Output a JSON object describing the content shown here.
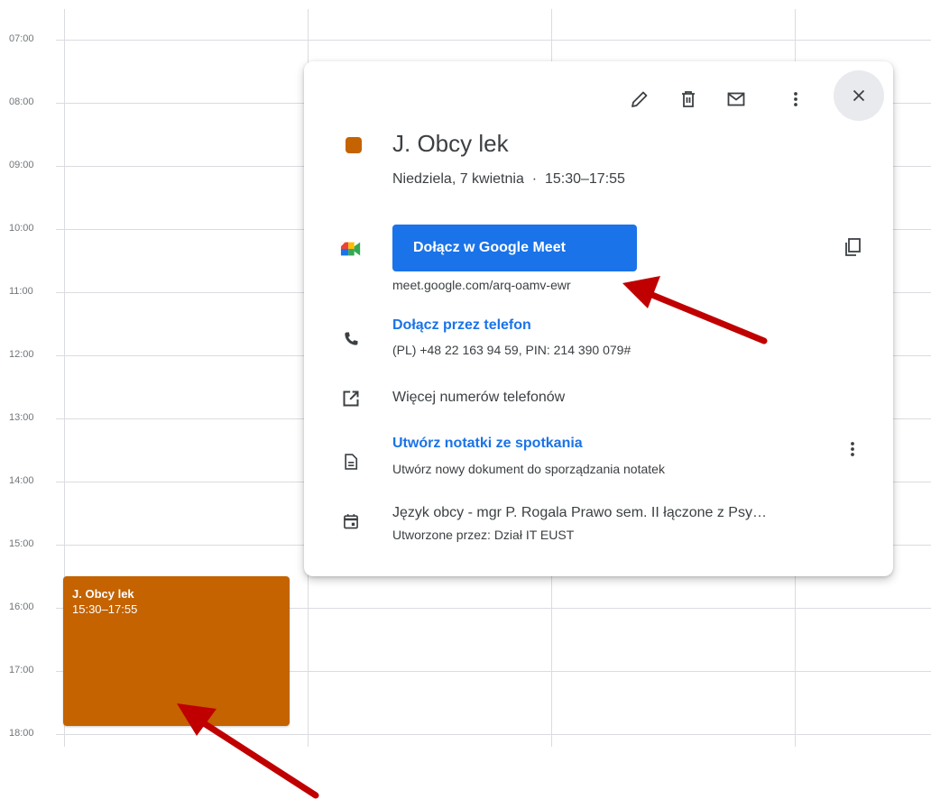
{
  "calendar": {
    "hours": [
      "07:00",
      "08:00",
      "09:00",
      "10:00",
      "11:00",
      "12:00",
      "13:00",
      "14:00",
      "15:00",
      "16:00",
      "17:00",
      "18:00"
    ]
  },
  "event_block": {
    "title": "J. Obcy lek",
    "time": "15:30–17:55",
    "color": "#c46300"
  },
  "popup": {
    "toolbar": {
      "edit_icon": "pencil-icon",
      "delete_icon": "trash-icon",
      "email_icon": "mail-icon",
      "more_icon": "more-vert-icon",
      "close_icon": "close-icon"
    },
    "title": "J. Obcy lek",
    "datetime": "Niedziela, 7 kwietnia  ·  15:30–17:55",
    "meet": {
      "button_label": "Dołącz w Google Meet",
      "url": "meet.google.com/arq-oamv-ewr"
    },
    "phone": {
      "link_label": "Dołącz przez telefon",
      "details": "(PL) +48 22 163 94 59, PIN: 214 390 079#"
    },
    "more_numbers_label": "Więcej numerów telefonów",
    "notes": {
      "link_label": "Utwórz notatki ze spotkania",
      "subtitle": "Utwórz nowy dokument do sporządzania notatek"
    },
    "calendar_info": {
      "name": "Język obcy - mgr P. Rogala Prawo sem. II łączone z Psy…",
      "created_by": "Utworzone przez: Dział IT EUST"
    }
  },
  "colors": {
    "accent": "#1a73e8",
    "arrow": "#c00000",
    "event": "#c46300"
  }
}
